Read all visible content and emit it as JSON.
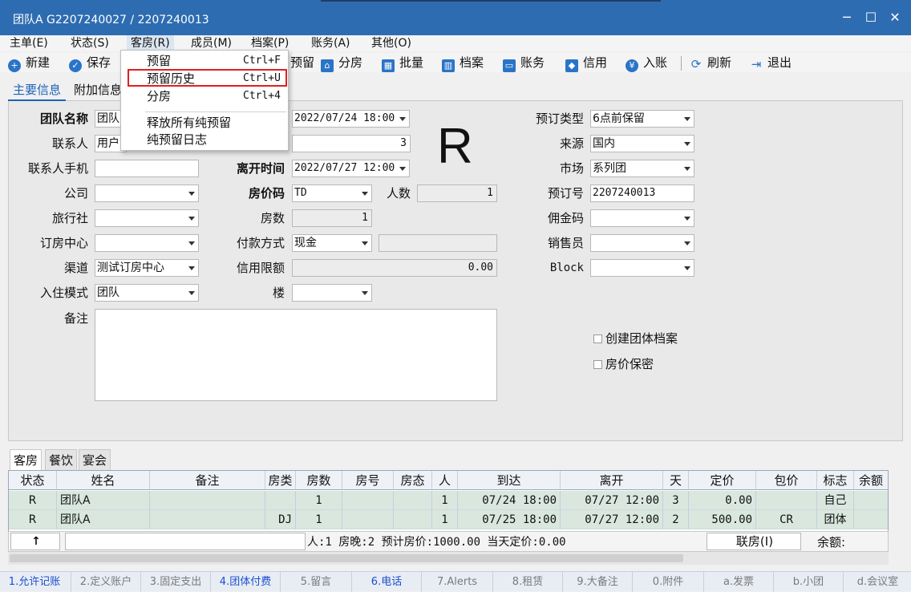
{
  "window": {
    "title": "团队A  G2207240027 / 2207240013"
  },
  "menubar": [
    "主单(E)",
    "状态(S)",
    "客房(R)",
    "成员(M)",
    "档案(P)",
    "账务(A)",
    "其他(O)"
  ],
  "toolbar": {
    "new": "新建",
    "save": "保存",
    "reserve_partial": "预留",
    "split_room": "分房",
    "batch": "批量",
    "profile": "档案",
    "account": "账务",
    "credit": "信用",
    "post": "入账",
    "refresh": "刷新",
    "exit": "退出"
  },
  "dropdown": {
    "items": [
      {
        "label": "预留",
        "shortcut": "Ctrl+F"
      },
      {
        "label": "预留历史",
        "shortcut": "Ctrl+U"
      },
      {
        "label": "分房",
        "shortcut": "Ctrl+4"
      },
      {
        "label": "释放所有纯预留",
        "shortcut": ""
      },
      {
        "label": "纯预留日志",
        "shortcut": ""
      }
    ]
  },
  "tabs": {
    "main": "主要信息",
    "extra": "附加信息"
  },
  "form": {
    "group_name_label": "团队名称",
    "group_name": "团队",
    "contact_label": "联系人",
    "contact": "用户",
    "contact_phone_label": "联系人手机",
    "contact_phone": "",
    "company_label": "公司",
    "company": "",
    "agency_label": "旅行社",
    "agency": "",
    "booking_center_label": "订房中心",
    "booking_center": "",
    "channel_label": "渠道",
    "channel": "测试订房中心",
    "checkin_mode_label": "入住模式",
    "checkin_mode": "团队",
    "remark_label": "备注",
    "remark": "",
    "arrival": "2022/07/24 18:00",
    "nights": "3",
    "departure_label": "离开时间",
    "departure": "2022/07/27 12:00",
    "rate_code_label": "房价码",
    "rate_code": "TD",
    "persons_label": "人数",
    "persons": "1",
    "rooms_label": "房数",
    "rooms": "1",
    "payment_label": "付款方式",
    "payment": "现金",
    "payment_extra": "",
    "credit_limit_label": "信用限额",
    "credit_limit": "0.00",
    "building_label": "楼",
    "building": "",
    "status_letter": "R",
    "booking_type_label": "预订类型",
    "booking_type": "6点前保留",
    "source_label": "来源",
    "source": "国内",
    "market_label": "市场",
    "market": "系列团",
    "booking_no_label": "预订号",
    "booking_no": "2207240013",
    "commission_label": "佣金码",
    "commission": "",
    "sales_label": "销售员",
    "sales": "",
    "block_label": "Block",
    "block": "",
    "create_profile": "创建团体档案",
    "rate_confidential": "房价保密"
  },
  "bottom_tabs": [
    "客房",
    "餐饮",
    "宴会"
  ],
  "grid": {
    "headers": [
      "状态",
      "姓名",
      "备注",
      "房类",
      "房数",
      "房号",
      "房态",
      "人",
      "到达",
      "离开",
      "天",
      "定价",
      "包价",
      "标志",
      "余额"
    ],
    "rows": [
      [
        "R",
        "团队A",
        "",
        "",
        "1",
        "",
        "",
        "1",
        "07/24 18:00",
        "07/27 12:00",
        "3",
        "0.00",
        "",
        "自己",
        ""
      ],
      [
        "R",
        "团队A",
        "",
        "DJ",
        "1",
        "",
        "",
        "1",
        "07/25 18:00",
        "07/27 12:00",
        "2",
        "500.00",
        "CR",
        "团体",
        ""
      ]
    ]
  },
  "grid_footer": {
    "up_button": "↑",
    "summary": "人:1  房晚:2  预计房价:1000.00  当天定价:0.00",
    "link_button": "联房(I)",
    "balance_label": "余额:"
  },
  "statusbar": [
    "1.允许记账",
    "2.定义账户",
    "3.固定支出",
    "4.团体付费",
    "5.留言",
    "6.电话",
    "7.Alerts",
    "8.租赁",
    "9.大备注",
    "0.附件",
    "a.发票",
    "b.小团",
    "d.会议室"
  ]
}
